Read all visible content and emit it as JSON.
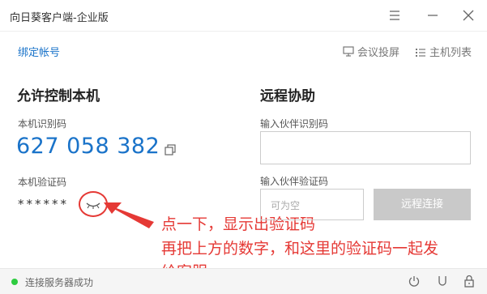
{
  "app": {
    "title": "向日葵客户端-企业版"
  },
  "nav": {
    "bind_account": "绑定帐号",
    "meeting_cast": "会议投屏",
    "host_list": "主机列表"
  },
  "allow": {
    "heading": "允许控制本机",
    "id_label": "本机识别码",
    "id_value": "627 058 382",
    "code_label": "本机验证码",
    "code_mask": "******"
  },
  "remote": {
    "heading": "远程协助",
    "partner_id_label": "输入伙伴识别码",
    "partner_code_label": "输入伙伴验证码",
    "partner_code_placeholder": "可为空",
    "connect_label": "远程连接"
  },
  "annotation": {
    "line1": "点一下，显示出验证码",
    "line2": "再把上方的数字，和这里的验证码一起发",
    "line3": "给客服"
  },
  "status": {
    "text": "连接服务器成功"
  },
  "colors": {
    "accent": "#1a73c9",
    "annotation": "#e53935",
    "status_ok": "#2ecc40",
    "button_disabled": "#c9c9c9"
  }
}
